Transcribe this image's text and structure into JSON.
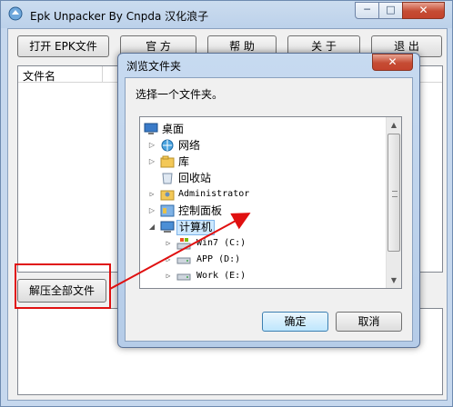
{
  "window": {
    "title": "Epk Unpacker By Cnpda 汉化浪子",
    "min_glyph": "─",
    "max_glyph": "□",
    "close_glyph": "✕"
  },
  "toolbar": {
    "open_label": "打开 EPK文件",
    "official_label": "官 方",
    "help_label": "帮 助",
    "about_label": "关 于",
    "exit_label": "退 出"
  },
  "file_list": {
    "column_header": "文件名"
  },
  "extract_all_label": "解压全部文件",
  "dialog": {
    "title": "浏览文件夹",
    "close_glyph": "✕",
    "prompt": "选择一个文件夹。",
    "ok_label": "确定",
    "cancel_label": "取消",
    "tree": [
      {
        "label": "桌面",
        "icon": "desktop-icon"
      },
      {
        "label": "网络",
        "icon": "network-icon"
      },
      {
        "label": "库",
        "icon": "library-icon"
      },
      {
        "label": "回收站",
        "icon": "recycle-bin-icon"
      },
      {
        "label": "Administrator",
        "icon": "user-folder-icon"
      },
      {
        "label": "控制面板",
        "icon": "control-panel-icon"
      },
      {
        "label": "计算机",
        "icon": "computer-icon"
      },
      {
        "label": "Win7 (C:)",
        "icon": "windows-drive-icon"
      },
      {
        "label": "APP (D:)",
        "icon": "drive-icon"
      },
      {
        "label": "Work (E:)",
        "icon": "drive-icon"
      }
    ]
  },
  "colors": {
    "annotation_red": "#e01010",
    "selection_bg": "#cde8ff"
  }
}
